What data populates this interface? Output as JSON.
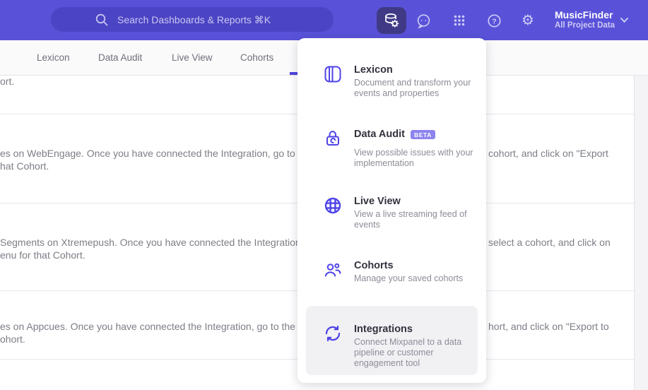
{
  "header": {
    "search_placeholder": "Search Dashboards & Reports ⌘K",
    "project_name": "MusicFinder",
    "project_scope": "All Project Data",
    "icons": {
      "active": "database-gear",
      "others": [
        "chat-smiley",
        "apps-grid",
        "help-question",
        "settings-gear"
      ]
    }
  },
  "tabs": {
    "items": [
      {
        "label": "Lexicon"
      },
      {
        "label": "Data Audit"
      },
      {
        "label": "Live View"
      },
      {
        "label": "Cohorts"
      }
    ]
  },
  "content": {
    "rows": [
      {
        "left": "ort.",
        "left2": "",
        "right": ""
      },
      {
        "left": "es on WebEngage. Once you have connected the Integration, go to the",
        "left2": "hat Cohort.",
        "right": "cohort, and click on \"Export"
      },
      {
        "left": "Segments on Xtremepush. Once you have connected the Integration,",
        "left2": "enu for that Cohort.",
        "right": "select a cohort, and click on"
      },
      {
        "left": "es on Appcues. Once you have connected the Integration, go to the M",
        "left2": "ohort.",
        "right": "hort, and click on \"Export to"
      }
    ]
  },
  "menu": {
    "items": [
      {
        "title": "Lexicon",
        "badge": "",
        "icon": "book",
        "description": "Document and transform your events and properties"
      },
      {
        "title": "Data Audit",
        "badge": "BETA",
        "icon": "lock-audit",
        "description": "View possible issues with your implementation"
      },
      {
        "title": "Live View",
        "badge": "",
        "icon": "globe",
        "description": "View a live streaming feed of events"
      },
      {
        "title": "Cohorts",
        "badge": "",
        "icon": "people",
        "description": "Manage your saved cohorts"
      },
      {
        "title": "Integrations",
        "badge": "",
        "icon": "sync-arrows",
        "description": "Connect Mixpanel to a data pipeline or customer engagement tool"
      }
    ]
  },
  "colors": {
    "header_bg": "#5952d9",
    "search_pill_bg": "#4b44c4",
    "active_tile_bg": "#403a86",
    "accent_purple": "#4f44e0",
    "icon_purple": "#4f43e8",
    "beta_badge_bg": "#8d83ee",
    "highlight_bg": "#f1f1f4"
  }
}
